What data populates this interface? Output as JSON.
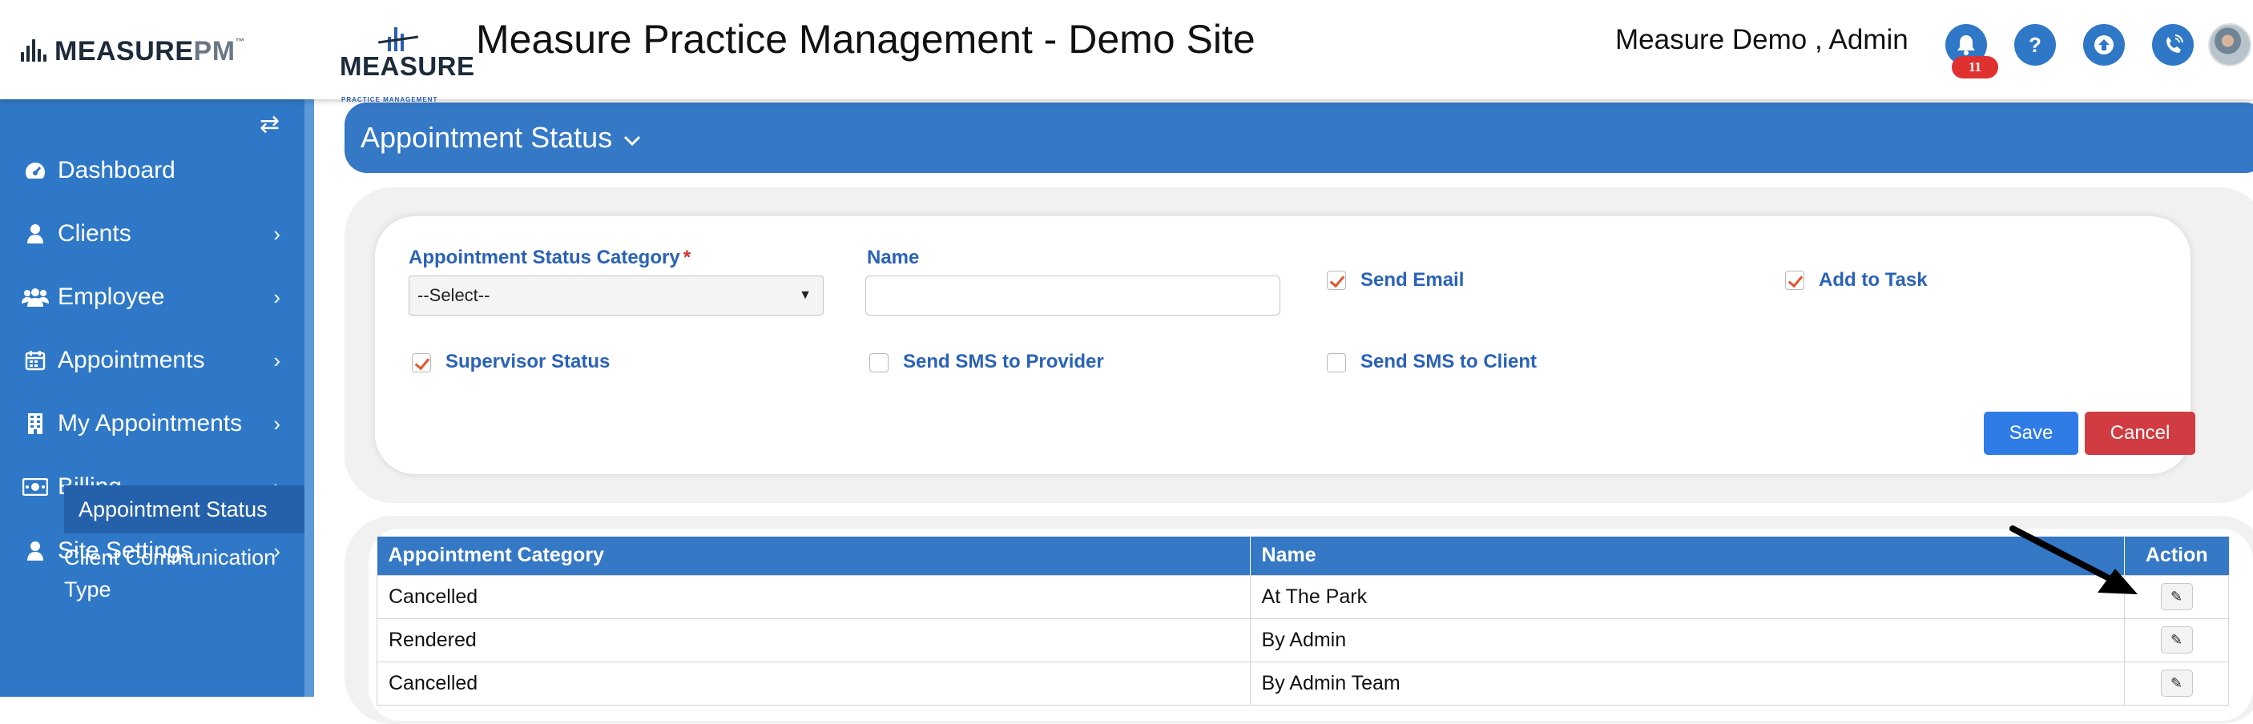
{
  "header": {
    "brand_main": "MEASURE",
    "brand_pm": "PM",
    "brand_tm": "™",
    "logo_word": "MEASURE",
    "logo_sub": "PRACTICE MANAGEMENT",
    "site_title": "Measure Practice Management - Demo Site",
    "user_name": "Measure Demo , Admin",
    "notification_count": "11",
    "help_glyph": "?",
    "icons": [
      "bell-icon",
      "help-icon",
      "upload-icon",
      "phone-icon"
    ]
  },
  "sidebar": {
    "items": [
      {
        "label": "Dashboard",
        "icon": "dashboard-icon",
        "has_children": false
      },
      {
        "label": "Clients",
        "icon": "user-icon",
        "has_children": true
      },
      {
        "label": "Employee",
        "icon": "users-icon",
        "has_children": true
      },
      {
        "label": "Appointments",
        "icon": "calendar-icon",
        "has_children": true
      },
      {
        "label": "My Appointments",
        "icon": "building-icon",
        "has_children": true
      },
      {
        "label": "Billing",
        "icon": "money-icon",
        "has_children": true
      },
      {
        "label": "Site Settings",
        "icon": "user-icon",
        "has_children": true
      }
    ],
    "sub_active": "Appointment Status",
    "sub_next": "Client Communication Type"
  },
  "page": {
    "title": "Appointment Status"
  },
  "form": {
    "category_label": "Appointment Status Category",
    "required_mark": "*",
    "category_value": "--Select--",
    "name_label": "Name",
    "name_value": "",
    "checkboxes": [
      {
        "label": "Send Email",
        "checked": true
      },
      {
        "label": "Add to Task",
        "checked": true
      },
      {
        "label": "Supervisor Status",
        "checked": true
      },
      {
        "label": "Send SMS to Provider",
        "checked": false
      },
      {
        "label": "Send SMS to Client",
        "checked": false
      }
    ],
    "save_label": "Save",
    "cancel_label": "Cancel"
  },
  "table": {
    "columns": [
      "Appointment Category",
      "Name",
      "Action"
    ],
    "rows": [
      {
        "category": "Cancelled",
        "name": "At The Park"
      },
      {
        "category": "Rendered",
        "name": "By Admin"
      },
      {
        "category": "Cancelled",
        "name": "By Admin Team"
      }
    ]
  },
  "colors": {
    "primary": "#3478c6",
    "sidebar": "#2f78c8",
    "save": "#2f7ce6",
    "cancel": "#d13c42",
    "label": "#2a62b8",
    "check": "#e4572e"
  }
}
